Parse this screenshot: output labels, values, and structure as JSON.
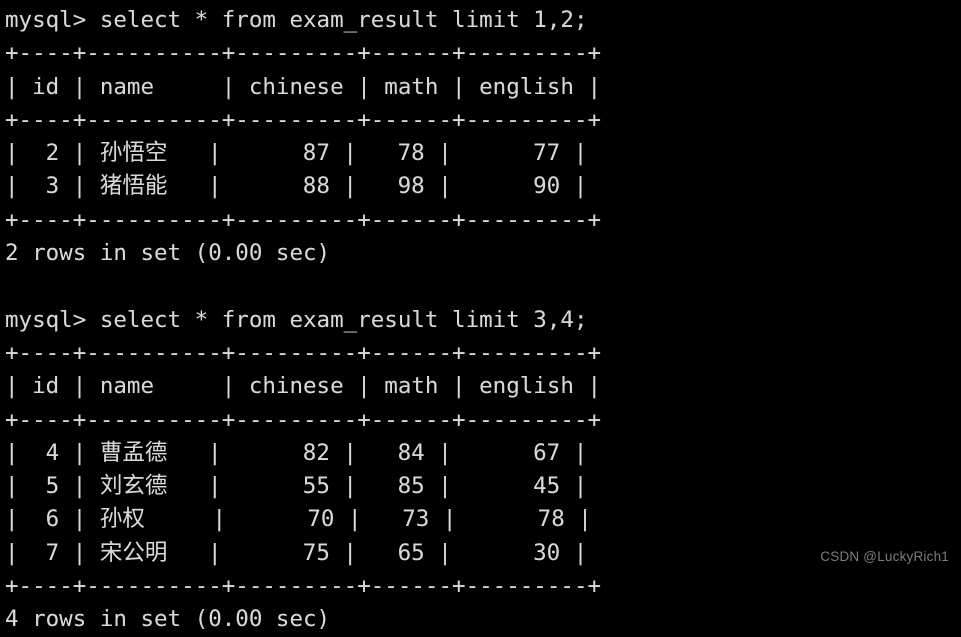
{
  "terminal": {
    "prompt": "mysql> ",
    "background_color": "#000000",
    "text_color": "#d8d8d8",
    "blocks": [
      {
        "command": "mysql> select * from exam_result limit 1,2;",
        "separator": "+----+----------+---------+------+---------+",
        "header": "| id | name     | chinese | math | english |",
        "rows": [
          "|  2 | 孙悟空   |      87 |   78 |      77 |",
          "|  3 | 猪悟能   |      88 |   98 |      90 |"
        ],
        "status": "2 rows in set (0.00 sec)"
      },
      {
        "command": "mysql> select * from exam_result limit 3,4;",
        "separator": "+----+----------+---------+------+---------+",
        "header": "| id | name     | chinese | math | english |",
        "rows": [
          "|  4 | 曹孟德   |      82 |   84 |      67 |",
          "|  5 | 刘玄德   |      55 |   85 |      45 |",
          "|  6 | 孙权     |      70 |   73 |      78 |",
          "|  7 | 宋公明   |      75 |   65 |      30 |"
        ],
        "status": "4 rows in set (0.00 sec)"
      }
    ],
    "lines": [
      "mysql> select * from exam_result limit 1,2;",
      "+----+----------+---------+------+---------+",
      "| id | name     | chinese | math | english |",
      "+----+----------+---------+------+---------+",
      "|  2 | 孙悟空   |      87 |   78 |      77 |",
      "|  3 | 猪悟能   |      88 |   98 |      90 |",
      "+----+----------+---------+------+---------+",
      "2 rows in set (0.00 sec)",
      "",
      "mysql> select * from exam_result limit 3,4;",
      "+----+----------+---------+------+---------+",
      "| id | name     | chinese | math | english |",
      "+----+----------+---------+------+---------+",
      "|  4 | 曹孟德   |      82 |   84 |      67 |",
      "|  5 | 刘玄德   |      55 |   85 |      45 |",
      "|  6 | 孙权     |      70 |   73 |      78 |",
      "|  7 | 宋公明   |      75 |   65 |      30 |",
      "+----+----------+---------+------+---------+",
      "4 rows in set (0.00 sec)"
    ],
    "table_columns": [
      "id",
      "name",
      "chinese",
      "math",
      "english"
    ],
    "result_sets": [
      {
        "query": "select * from exam_result limit 1,2;",
        "records": [
          {
            "id": "2",
            "name": "孙悟空",
            "chinese": "87",
            "math": "78",
            "english": "77"
          },
          {
            "id": "3",
            "name": "猪悟能",
            "chinese": "88",
            "math": "98",
            "english": "90"
          }
        ],
        "row_count": "2"
      },
      {
        "query": "select * from exam_result limit 3,4;",
        "records": [
          {
            "id": "4",
            "name": "曹孟德",
            "chinese": "82",
            "math": "84",
            "english": "67"
          },
          {
            "id": "5",
            "name": "刘玄德",
            "chinese": "55",
            "math": "85",
            "english": "45"
          },
          {
            "id": "6",
            "name": "孙权",
            "chinese": "70",
            "math": "73",
            "english": "78"
          },
          {
            "id": "7",
            "name": "宋公明",
            "chinese": "75",
            "math": "65",
            "english": "30"
          }
        ],
        "row_count": "4"
      }
    ]
  },
  "watermark": {
    "text": "CSDN @LuckyRich1",
    "color": "#7c7c7c"
  }
}
